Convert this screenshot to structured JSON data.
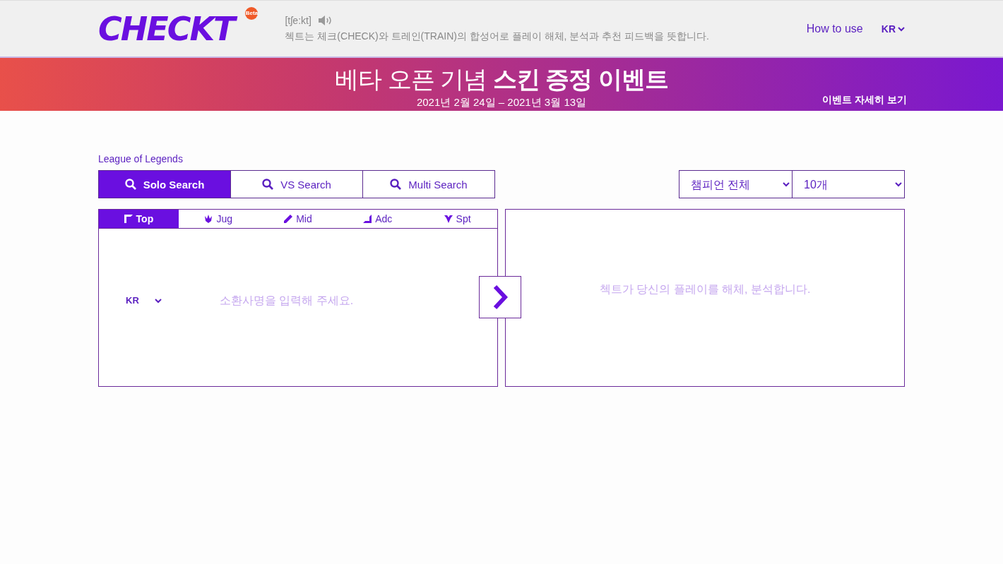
{
  "header": {
    "logo": "CHECKT",
    "logo_badge": "Beta",
    "pronunciation": "[tʃe:kt]",
    "description": "첵트는 체크(CHECK)와 트레인(TRAIN)의 합성어로 플레이 해체, 분석과 추천 피드백을 뜻합니다.",
    "how_to_use": "How to use",
    "language": "KR"
  },
  "banner": {
    "title": "베타 오픈 기념 **스킨 증정 이벤트**",
    "dates": "2021년 2월 24일 – 2021년 3월 13일",
    "link": "이벤트 자세히 보기"
  },
  "game_label": "League of Legends",
  "search_tabs": [
    {
      "label": "Solo Search",
      "selected": true
    },
    {
      "label": "VS Search",
      "selected": false
    },
    {
      "label": "Multi Search",
      "selected": false
    }
  ],
  "filters": [
    {
      "value": "챔피언 전체"
    },
    {
      "value": "10개"
    }
  ],
  "roles": [
    {
      "kind": "top",
      "label": "Top",
      "selected": true
    },
    {
      "kind": "jungle",
      "label": "Jug",
      "selected": false
    },
    {
      "kind": "mid",
      "label": "Mid",
      "selected": false
    },
    {
      "kind": "adc",
      "label": "Adc",
      "selected": false
    },
    {
      "kind": "support",
      "label": "Spt",
      "selected": false
    }
  ],
  "search_panel": {
    "region": "KR",
    "placeholder": "소환사명을 입력해 주세요."
  },
  "result_panel": {
    "message": "첵트가 당신의 플레이를 해체, 분석합니다."
  }
}
